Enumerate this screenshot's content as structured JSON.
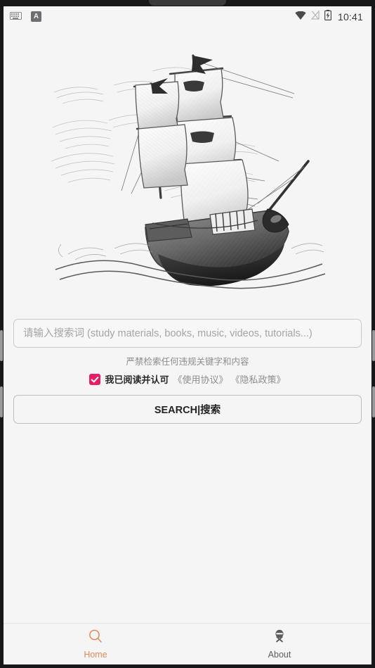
{
  "status_bar": {
    "keyboard_icon": "keyboard-icon",
    "ime_icon_label": "A",
    "wifi_icon": "wifi-icon",
    "signal_off_icon": "signal-disabled-icon",
    "battery_icon": "battery-charging-icon",
    "time": "10:41"
  },
  "hero": {
    "illustration": "sailing-ship-pencil-sketch"
  },
  "search": {
    "placeholder": "请输入搜索词 (study materials, books, music, videos, tutorials...)",
    "value": "",
    "warning": "严禁检索任何违规关键字和内容",
    "agreement_checked_label": "我已阅读并认可",
    "terms_link": "《使用协议》",
    "privacy_link": "《隐私政策》",
    "button_label": "SEARCH|搜索",
    "checkbox_color": "#e61e64"
  },
  "bottom_nav": {
    "active_color": "#e08a5a",
    "inactive_color": "#5c5c5e",
    "items": [
      {
        "label": "Home",
        "icon": "search-icon",
        "active": true
      },
      {
        "label": "About",
        "icon": "medal-icon",
        "active": false
      }
    ]
  }
}
